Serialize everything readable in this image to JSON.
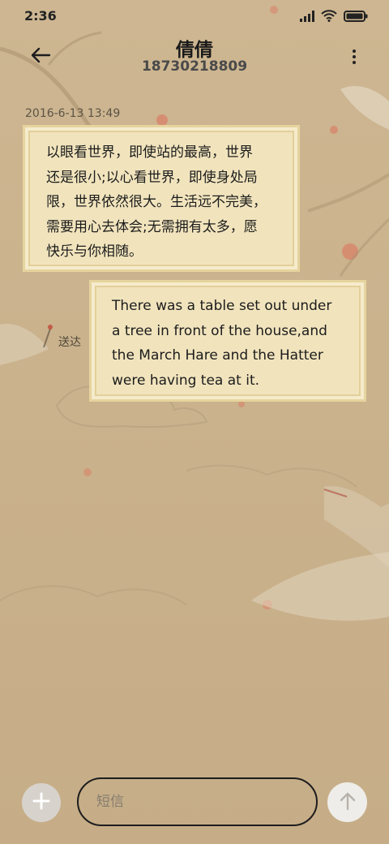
{
  "status_bar": {
    "time": "2:36",
    "icons": [
      "signal-icon",
      "wifi-icon",
      "battery-icon"
    ]
  },
  "header": {
    "contact_name": "倩倩",
    "contact_number": "18730218809",
    "back_icon": "back-arrow-icon",
    "menu_icon": "more-vertical-icon"
  },
  "conversation": {
    "timestamp": "2016-6-13 13:49",
    "messages": [
      {
        "direction": "incoming",
        "lines": [
          "以眼看世界，即使站的最高，世界",
          "还是很小;以心看世界，即使身处局",
          "限，世界依然很大。生活远不完美，",
          "需要用心去体会;无需拥有太多，愿",
          "快乐与你相随。"
        ]
      },
      {
        "direction": "outgoing",
        "status": "送达",
        "lines": [
          "There was a table set out under",
          "a tree in front of the house,and",
          "the March Hare and the Hatter",
          "were having tea at it."
        ]
      }
    ]
  },
  "composer": {
    "placeholder": "短信",
    "value": "",
    "add_icon": "plus-icon",
    "send_icon": "arrow-up-icon"
  },
  "colors": {
    "background": "#c9b18d",
    "bubble": "#f1e4bd",
    "bubble_border": "#e6d49e",
    "send_button": "#efede9",
    "add_button": "#d7d2cb"
  }
}
